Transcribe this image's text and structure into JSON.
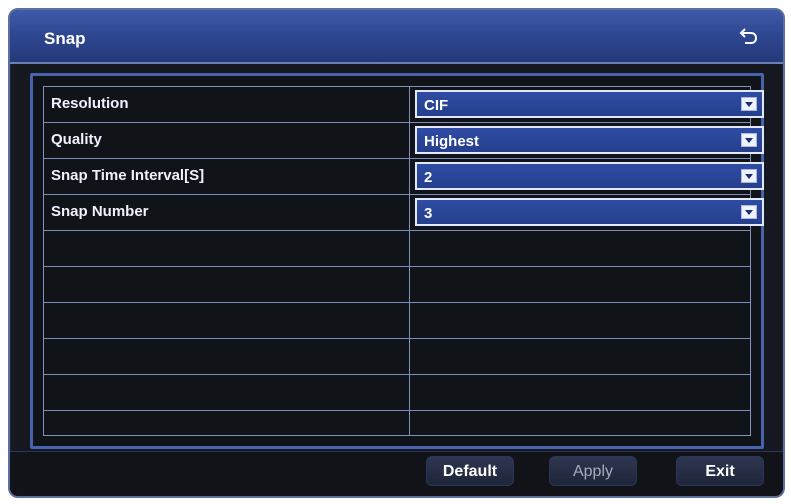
{
  "window": {
    "title": "Snap",
    "back_icon": "back-arrow-icon"
  },
  "settings": [
    {
      "label": "Resolution",
      "value": "CIF"
    },
    {
      "label": "Quality",
      "value": "Highest"
    },
    {
      "label": "Snap Time Interval[S]",
      "value": "2"
    },
    {
      "label": "Snap Number",
      "value": "3"
    }
  ],
  "footer": {
    "default_label": "Default",
    "apply_label": "Apply",
    "exit_label": "Exit"
  },
  "colors": {
    "titlebar": "#2f4892",
    "select_bg": "#2f4ca5",
    "border": "#4863ae"
  }
}
